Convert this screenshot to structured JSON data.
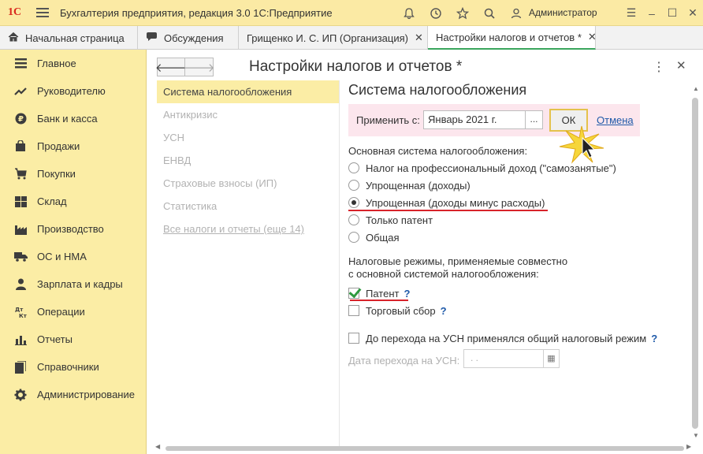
{
  "app": {
    "logo": "1С",
    "title": "Бухгалтерия предприятия, редакция 3.0 1С:Предприятие",
    "user": "Администратор"
  },
  "tabs": [
    {
      "label": "Начальная страница",
      "icon": "home-icon"
    },
    {
      "label": "Обсуждения",
      "icon": "chat-icon"
    },
    {
      "label": "Грищенко И. С. ИП (Организация)",
      "icon": "",
      "closable": true
    },
    {
      "label": "Настройки налогов и отчетов *",
      "icon": "",
      "closable": true,
      "active": true
    }
  ],
  "sidebar": {
    "items": [
      {
        "label": "Главное",
        "icon": "menu-icon"
      },
      {
        "label": "Руководителю",
        "icon": "trend-icon"
      },
      {
        "label": "Банк и касса",
        "icon": "ruble-icon"
      },
      {
        "label": "Продажи",
        "icon": "bag-icon"
      },
      {
        "label": "Покупки",
        "icon": "cart-icon"
      },
      {
        "label": "Склад",
        "icon": "warehouse-icon"
      },
      {
        "label": "Производство",
        "icon": "factory-icon"
      },
      {
        "label": "ОС и НМА",
        "icon": "truck-icon"
      },
      {
        "label": "Зарплата и кадры",
        "icon": "person-icon"
      },
      {
        "label": "Операции",
        "icon": "dt-kt-icon"
      },
      {
        "label": "Отчеты",
        "icon": "report-icon"
      },
      {
        "label": "Справочники",
        "icon": "book-icon"
      },
      {
        "label": "Администрирование",
        "icon": "gear-icon"
      }
    ]
  },
  "form": {
    "title": "Настройки налогов и отчетов *",
    "sections": [
      {
        "label": "Система налогообложения",
        "selected": true
      },
      {
        "label": "Антикризис"
      },
      {
        "label": "УСН"
      },
      {
        "label": "ЕНВД"
      },
      {
        "label": "Страховые взносы (ИП)"
      },
      {
        "label": "Статистика"
      },
      {
        "label": "Все налоги и отчеты (еще 14)",
        "link": true
      }
    ],
    "section_title": "Система налогообложения",
    "apply": {
      "label": "Применить с:",
      "value": "Январь 2021 г.",
      "picker": "...",
      "ok": "ОК",
      "cancel": "Отмена"
    },
    "main_system_label": "Основная система налогообложения:",
    "radios": [
      {
        "label": "Налог на профессиональный доход (\"самозанятые\")",
        "checked": false
      },
      {
        "label": "Упрощенная (доходы)",
        "checked": false
      },
      {
        "label": "Упрощенная (доходы минус расходы)",
        "checked": true
      },
      {
        "label": "Только патент",
        "checked": false
      },
      {
        "label": "Общая",
        "checked": false
      }
    ],
    "combined_label_1": "Налоговые режимы, применяемые совместно",
    "combined_label_2": "с основной системой налогообложения:",
    "checkboxes": [
      {
        "label": "Патент",
        "checked": true,
        "help": "?"
      },
      {
        "label": "Торговый сбор",
        "checked": false,
        "help": "?"
      }
    ],
    "prior_general": {
      "label": "До перехода на УСН применялся общий налоговый режим",
      "checked": false,
      "help": "?"
    },
    "transition_date": {
      "label": "Дата перехода на УСН:",
      "value": ".  ."
    }
  },
  "colors": {
    "sidebar_bg": "#fbeda5",
    "accent_red": "#d8232a",
    "ok_border": "#e4c24c",
    "apply_bg": "#fce6ed",
    "link": "#1f5aa9"
  }
}
